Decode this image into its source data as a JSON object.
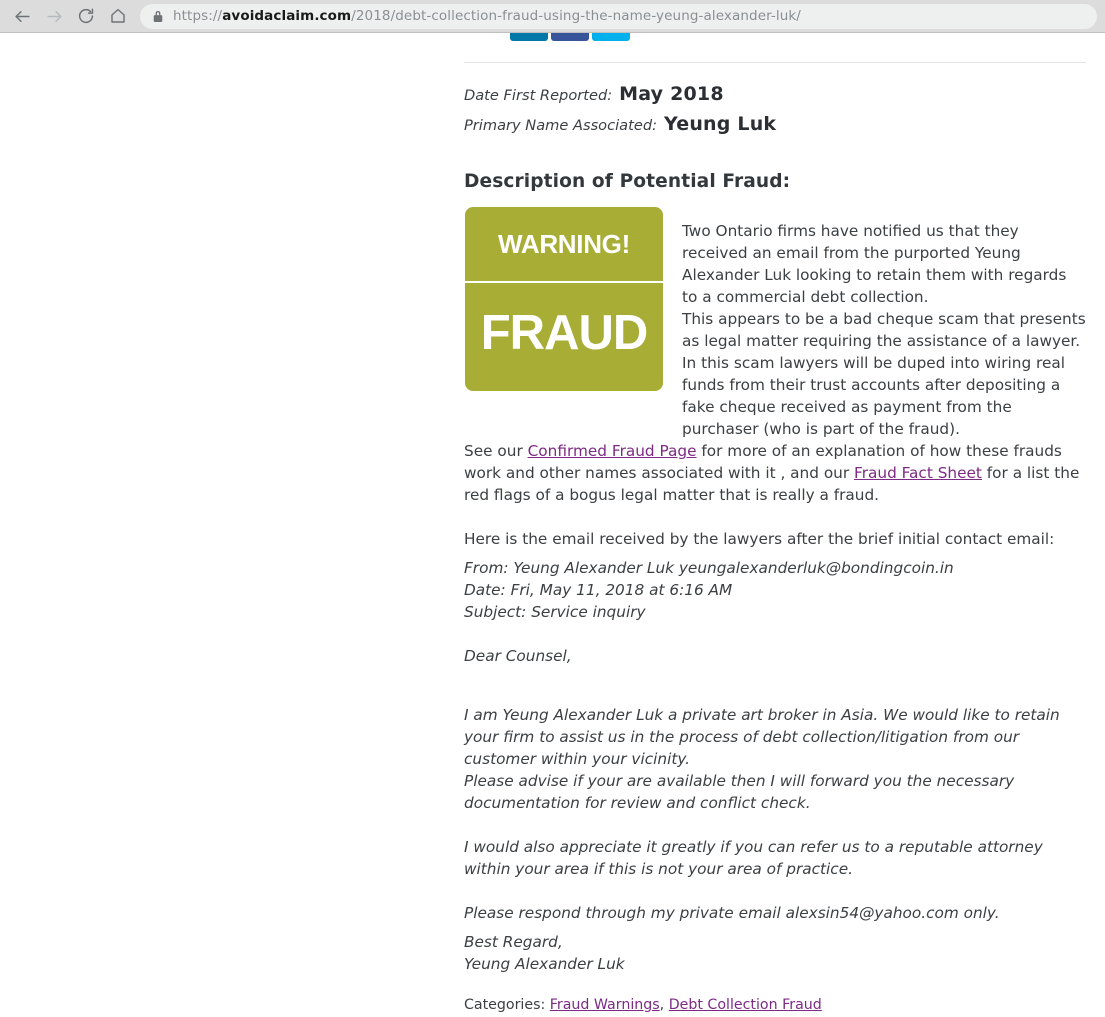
{
  "browser": {
    "back_icon": "back-arrow-icon",
    "forward_icon": "forward-arrow-icon",
    "reload_icon": "reload-icon",
    "home_icon": "home-icon",
    "lock_icon": "lock-icon",
    "url_scheme": "https://",
    "url_domain": "avoidaclaim.com",
    "url_path": "/2018/debt-collection-fraud-using-the-name-yeung-alexander-luk/",
    "url_full": "https://avoidaclaim.com/2018/debt-collection-fraud-using-the-name-yeung-alexander-luk/"
  },
  "share": {
    "buttons": [
      {
        "name": "linkedin-share-button",
        "color": "#0277a8"
      },
      {
        "name": "facebook-share-button",
        "color": "#38549b"
      },
      {
        "name": "twitter-share-button",
        "color": "#00b0ec"
      }
    ]
  },
  "meta": {
    "date_label": "Date First Reported:",
    "date_value": "May 2018",
    "name_label": "Primary Name Associated:",
    "name_value": "Yeung Luk"
  },
  "article": {
    "heading": "Description of Potential Fraud:",
    "warning_graphic": {
      "top_text": "WARNING!",
      "bottom_text": "FRAUD",
      "color": "#a8ad35"
    },
    "para_1": "Two Ontario firms have notified us that they received an email from the purported Yeung Alexander Luk looking to retain them with regards to a commercial debt collection.",
    "para_2": "This appears to be a bad cheque scam that presents as legal matter requiring the assistance of a lawyer. In this scam lawyers will be duped into wiring real funds from their trust accounts after depositing a fake cheque received as payment from the purchaser (who is part of the fraud).",
    "see_our_prefix": "See our ",
    "link_confirmed_fraud_page": "Confirmed Fraud Page",
    "see_our_middle": " for more of an explanation of how these frauds work and other names associated with it , and our ",
    "link_fraud_fact_sheet": "Fraud Fact Sheet",
    "see_our_suffix": " for a list the red flags of a bogus legal matter that is really a fraud.",
    "here_is": "Here is the email received by the lawyers after the brief initial contact email:"
  },
  "email": {
    "from": "From: Yeung Alexander Luk yeungalexanderluk@bondingcoin.in",
    "date": "Date: Fri, May 11, 2018 at 6:16 AM",
    "subject": "Subject: Service inquiry",
    "greeting": "Dear Counsel,",
    "p1": "I am Yeung Alexander Luk a private art broker in Asia. We would like to retain your firm to assist us in the process of debt collection/litigation from our customer within your vicinity.",
    "p2": "Please advise if your are available then I will forward you the necessary documentation for review and conflict check.",
    "p3": "I would also appreciate it greatly if you can refer us to a reputable attorney within your area if this is not your area of practice.",
    "p4": "Please respond through my private email alexsin54@yahoo.com only.",
    "sign_1": "Best Regard,",
    "sign_2": "Yeung Alexander Luk"
  },
  "categories": {
    "label": "Categories: ",
    "item_1": "Fraud Warnings",
    "separator": ", ",
    "item_2": "Debt Collection Fraud"
  },
  "colors": {
    "link": "#7d2a84",
    "warning": "#a8ad35",
    "text": "#3c4043"
  }
}
